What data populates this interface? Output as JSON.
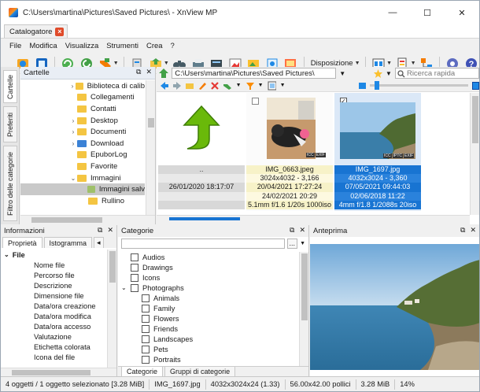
{
  "window": {
    "title": "C:\\Users\\martina\\Pictures\\Saved Pictures\\ - XnView MP",
    "controls": [
      "—",
      "☐",
      "✕"
    ]
  },
  "tab": {
    "label": "Catalogatore",
    "close": "×"
  },
  "menu": [
    "File",
    "Modifica",
    "Visualizza",
    "Strumenti",
    "Crea",
    "?"
  ],
  "toolbar": {
    "view_label": "Disposizione"
  },
  "side_tabs": [
    "Cartelle",
    "Preferiti",
    "Filtro delle categorie"
  ],
  "folders": {
    "title": "Cartelle",
    "head_buttons": [
      "⧉",
      "✕"
    ],
    "items": [
      {
        "label": "Biblioteca di calib",
        "arrow": "›",
        "indent": 0,
        "icon": "folder-icon"
      },
      {
        "label": "Collegamenti",
        "arrow": "",
        "indent": 0,
        "icon": "folder-icon"
      },
      {
        "label": "Contatti",
        "arrow": "",
        "indent": 0,
        "icon": "folder-icon"
      },
      {
        "label": "Desktop",
        "arrow": "›",
        "indent": 0,
        "icon": "folder-icon"
      },
      {
        "label": "Documenti",
        "arrow": "›",
        "indent": 0,
        "icon": "folder-icon"
      },
      {
        "label": "Download",
        "arrow": "›",
        "indent": 0,
        "icon": "download-folder-icon"
      },
      {
        "label": "EpuborLog",
        "arrow": "",
        "indent": 0,
        "icon": "folder-icon"
      },
      {
        "label": "Favorite",
        "arrow": "",
        "indent": 0,
        "icon": "folder-icon"
      },
      {
        "label": "Immagini",
        "arrow": "⌄",
        "indent": 0,
        "icon": "pictures-folder-icon"
      },
      {
        "label": "Immagini salv",
        "arrow": "",
        "indent": 1,
        "icon": "folder-icon",
        "selected": true
      },
      {
        "label": "Rullino",
        "arrow": "",
        "indent": 1,
        "icon": "folder-icon"
      }
    ]
  },
  "browser": {
    "path": "C:\\Users\\martina\\Pictures\\Saved Pictures\\",
    "search_placeholder": "Ricerca rapida",
    "cells": [
      {
        "kind": "parent",
        "name": "..",
        "lines": [
          "26/01/2020 18:17:07"
        ]
      },
      {
        "kind": "image",
        "name": "IMG_0663.jpeg",
        "lines": [
          "3024x4032 - 3,166",
          "20/04/2021 17:27:24",
          "24/02/2021 20:29",
          "5.1mm f/1.6 1/20s 1000iso"
        ],
        "badges": [
          "ICC",
          "EXIF"
        ]
      },
      {
        "kind": "image",
        "name": "IMG_1697.jpg",
        "lines": [
          "4032x3024 - 3,360",
          "07/05/2021 09:44:03",
          "02/06/2018 11:22",
          "4mm f/1.8 1/2088s 20iso"
        ],
        "badges": [
          "ICC",
          "IPTC",
          "EXIF"
        ],
        "selected": true
      }
    ]
  },
  "info": {
    "title": "Informazioni",
    "tabs": [
      "Proprietà",
      "Istogramma"
    ],
    "group": "File",
    "fields": [
      "Nome file",
      "Percorso file",
      "Descrizione",
      "Dimensione file",
      "Data/ora creazione",
      "Data/ora modifica",
      "Data/ora accesso",
      "Valutazione",
      "Etichetta colorata",
      "Icona del file"
    ]
  },
  "categories": {
    "title": "Categorie",
    "more_button": "...",
    "items": [
      {
        "label": "Audios",
        "indent": 0,
        "expand": ""
      },
      {
        "label": "Drawings",
        "indent": 0,
        "expand": ""
      },
      {
        "label": "Icons",
        "indent": 0,
        "expand": ""
      },
      {
        "label": "Photographs",
        "indent": 0,
        "expand": "⌄"
      },
      {
        "label": "Animals",
        "indent": 1,
        "expand": ""
      },
      {
        "label": "Family",
        "indent": 1,
        "expand": ""
      },
      {
        "label": "Flowers",
        "indent": 1,
        "expand": ""
      },
      {
        "label": "Friends",
        "indent": 1,
        "expand": ""
      },
      {
        "label": "Landscapes",
        "indent": 1,
        "expand": ""
      },
      {
        "label": "Pets",
        "indent": 1,
        "expand": ""
      },
      {
        "label": "Portraits",
        "indent": 1,
        "expand": ""
      }
    ],
    "bottom_tabs": [
      "Categorie",
      "Gruppi di categorie"
    ]
  },
  "preview": {
    "title": "Anteprima"
  },
  "status": [
    "4 oggetti / 1 oggetto selezionato [3.28 MiB]",
    "IMG_1697.jpg",
    "4032x3024x24 (1.33)",
    "56.00x42.00 pollici",
    "3.28 MiB",
    "14%"
  ],
  "colors": {
    "selection": "#1874d2",
    "accent_orange": "#e04b2a",
    "panel_head": "#e9eef5"
  }
}
